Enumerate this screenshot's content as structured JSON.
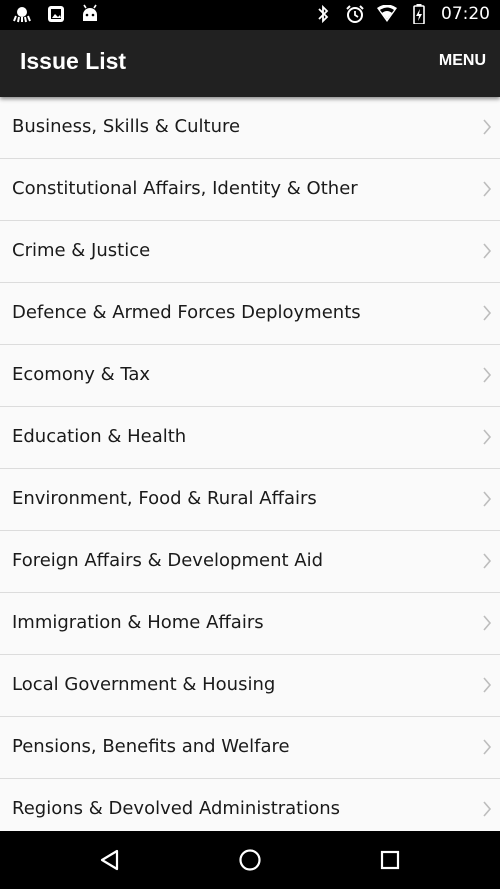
{
  "status_bar": {
    "time": "07:20",
    "left_icons": [
      "octopus-icon",
      "photo-frame-icon",
      "android-icon"
    ],
    "right_icons": [
      "bluetooth-icon",
      "alarm-icon",
      "wifi-icon",
      "battery-charging-icon"
    ]
  },
  "app_bar": {
    "title": "Issue List",
    "menu_label": "MENU",
    "background": "#212121"
  },
  "issues": [
    {
      "label": "Business, Skills & Culture"
    },
    {
      "label": "Constitutional Affairs, Identity & Other"
    },
    {
      "label": "Crime & Justice"
    },
    {
      "label": "Defence & Armed Forces Deployments"
    },
    {
      "label": "Ecomony & Tax"
    },
    {
      "label": "Education & Health"
    },
    {
      "label": "Environment, Food & Rural Affairs"
    },
    {
      "label": "Foreign Affairs & Development Aid"
    },
    {
      "label": "Immigration & Home Affairs"
    },
    {
      "label": "Local Government & Housing"
    },
    {
      "label": "Pensions, Benefits and Welfare"
    },
    {
      "label": "Regions & Devolved Administrations"
    }
  ],
  "nav_bar": {
    "buttons": [
      "back-icon",
      "home-icon",
      "recents-icon"
    ]
  }
}
